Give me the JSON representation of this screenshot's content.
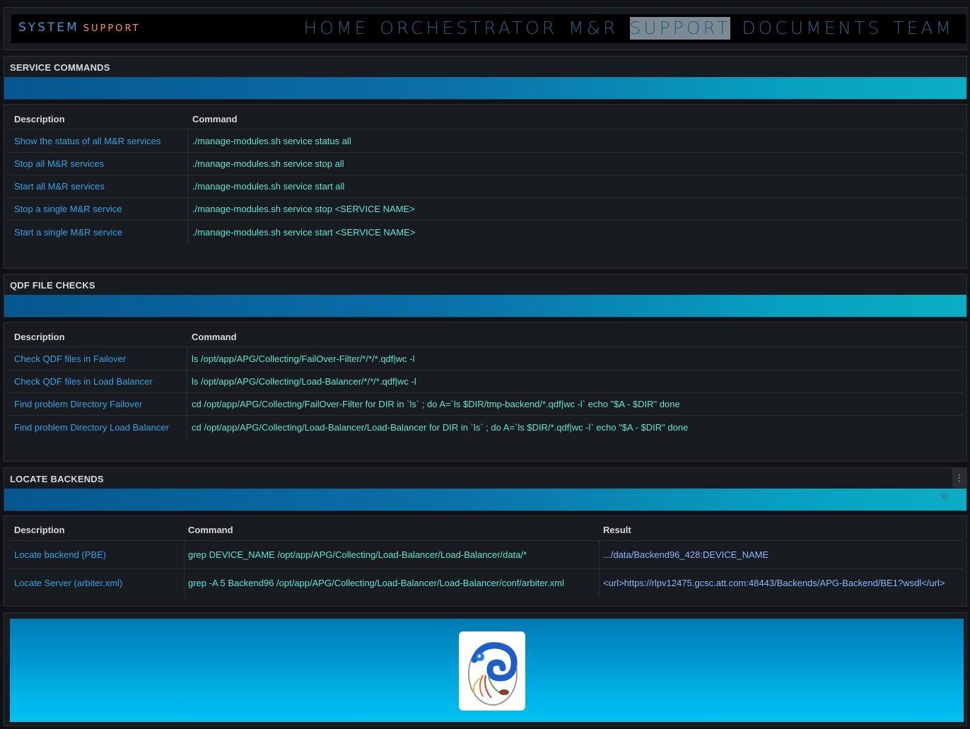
{
  "header": {
    "brand_system": "SYSTEM",
    "brand_support": "SUPPORT",
    "nav": [
      "HOME",
      "ORCHESTRATOR",
      "M&R",
      "SUPPORT",
      "DOCUMENTS",
      "TEAM"
    ],
    "active_nav": "SUPPORT"
  },
  "service_commands": {
    "title": "SERVICE COMMANDS",
    "headers": {
      "description": "Description",
      "command": "Command"
    },
    "rows": [
      {
        "description": "Show the status of all M&R services",
        "command": "./manage-modules.sh service status all"
      },
      {
        "description": "Stop all M&R services",
        "command": "./manage-modules.sh service stop all"
      },
      {
        "description": "Start all M&R services",
        "command": "./manage-modules.sh service start all"
      },
      {
        "description": "Stop a single M&R service",
        "command": "./manage-modules.sh service stop <SERVICE NAME>"
      },
      {
        "description": "Start a single M&R service",
        "command": "./manage-modules.sh service start <SERVICE NAME>"
      }
    ]
  },
  "qdf_checks": {
    "title": "QDF FILE CHECKS",
    "headers": {
      "description": "Description",
      "command": "Command"
    },
    "rows": [
      {
        "description": "Check QDF files in Failover",
        "command": "ls /opt/app/APG/Collecting/FailOver-Filter/*/*/*.qdf|wc -l"
      },
      {
        "description": "Check QDF files in Load Balancer",
        "command": "ls /opt/app/APG/Collecting/Load-Balancer/*/*/*.qdf|wc -l"
      },
      {
        "description": "Find problem Directory Failover",
        "command": "cd /opt/app/APG/Collecting/FailOver-Filter for DIR in `ls` ; do A=`ls $DIR/tmp-backend/*.qdf|wc -l` echo \"$A - $DIR\" done"
      },
      {
        "description": "Find problem Directory Load Balancer",
        "command": "cd /opt/app/APG/Collecting/Load-Balancer/Load-Balancer for DIR in `ls` ; do A=`ls $DIR/*.qdf|wc -l` echo \"$A - $DIR\" done"
      }
    ]
  },
  "locate_backends": {
    "title": "LOCATE BACKENDS",
    "headers": {
      "description": "Description",
      "command": "Command",
      "result": "Result"
    },
    "rows": [
      {
        "description": "Locate backend (PBE)",
        "command": "grep DEVICE_NAME /opt/app/APG/Collecting/Load-Balancer/Load-Balancer/data/*",
        "result": ".../data/Backend96_428:DEVICE_NAME"
      },
      {
        "description": "Locate Server (arbiter.xml)",
        "command": "grep -A 5 Backend96 /opt/app/APG/Collecting/Load-Balancer/Load-Balancer/conf/arbiter.xml",
        "result": "<url>https://rlpv12475.gcsc.att.com:48443/Backends/APG-Backend/BE1?wsdl</url>"
      }
    ]
  },
  "icons": {
    "panel_menu": "vertical-dots-icon",
    "move": "move-icon",
    "logo": "chameleon-logo"
  }
}
